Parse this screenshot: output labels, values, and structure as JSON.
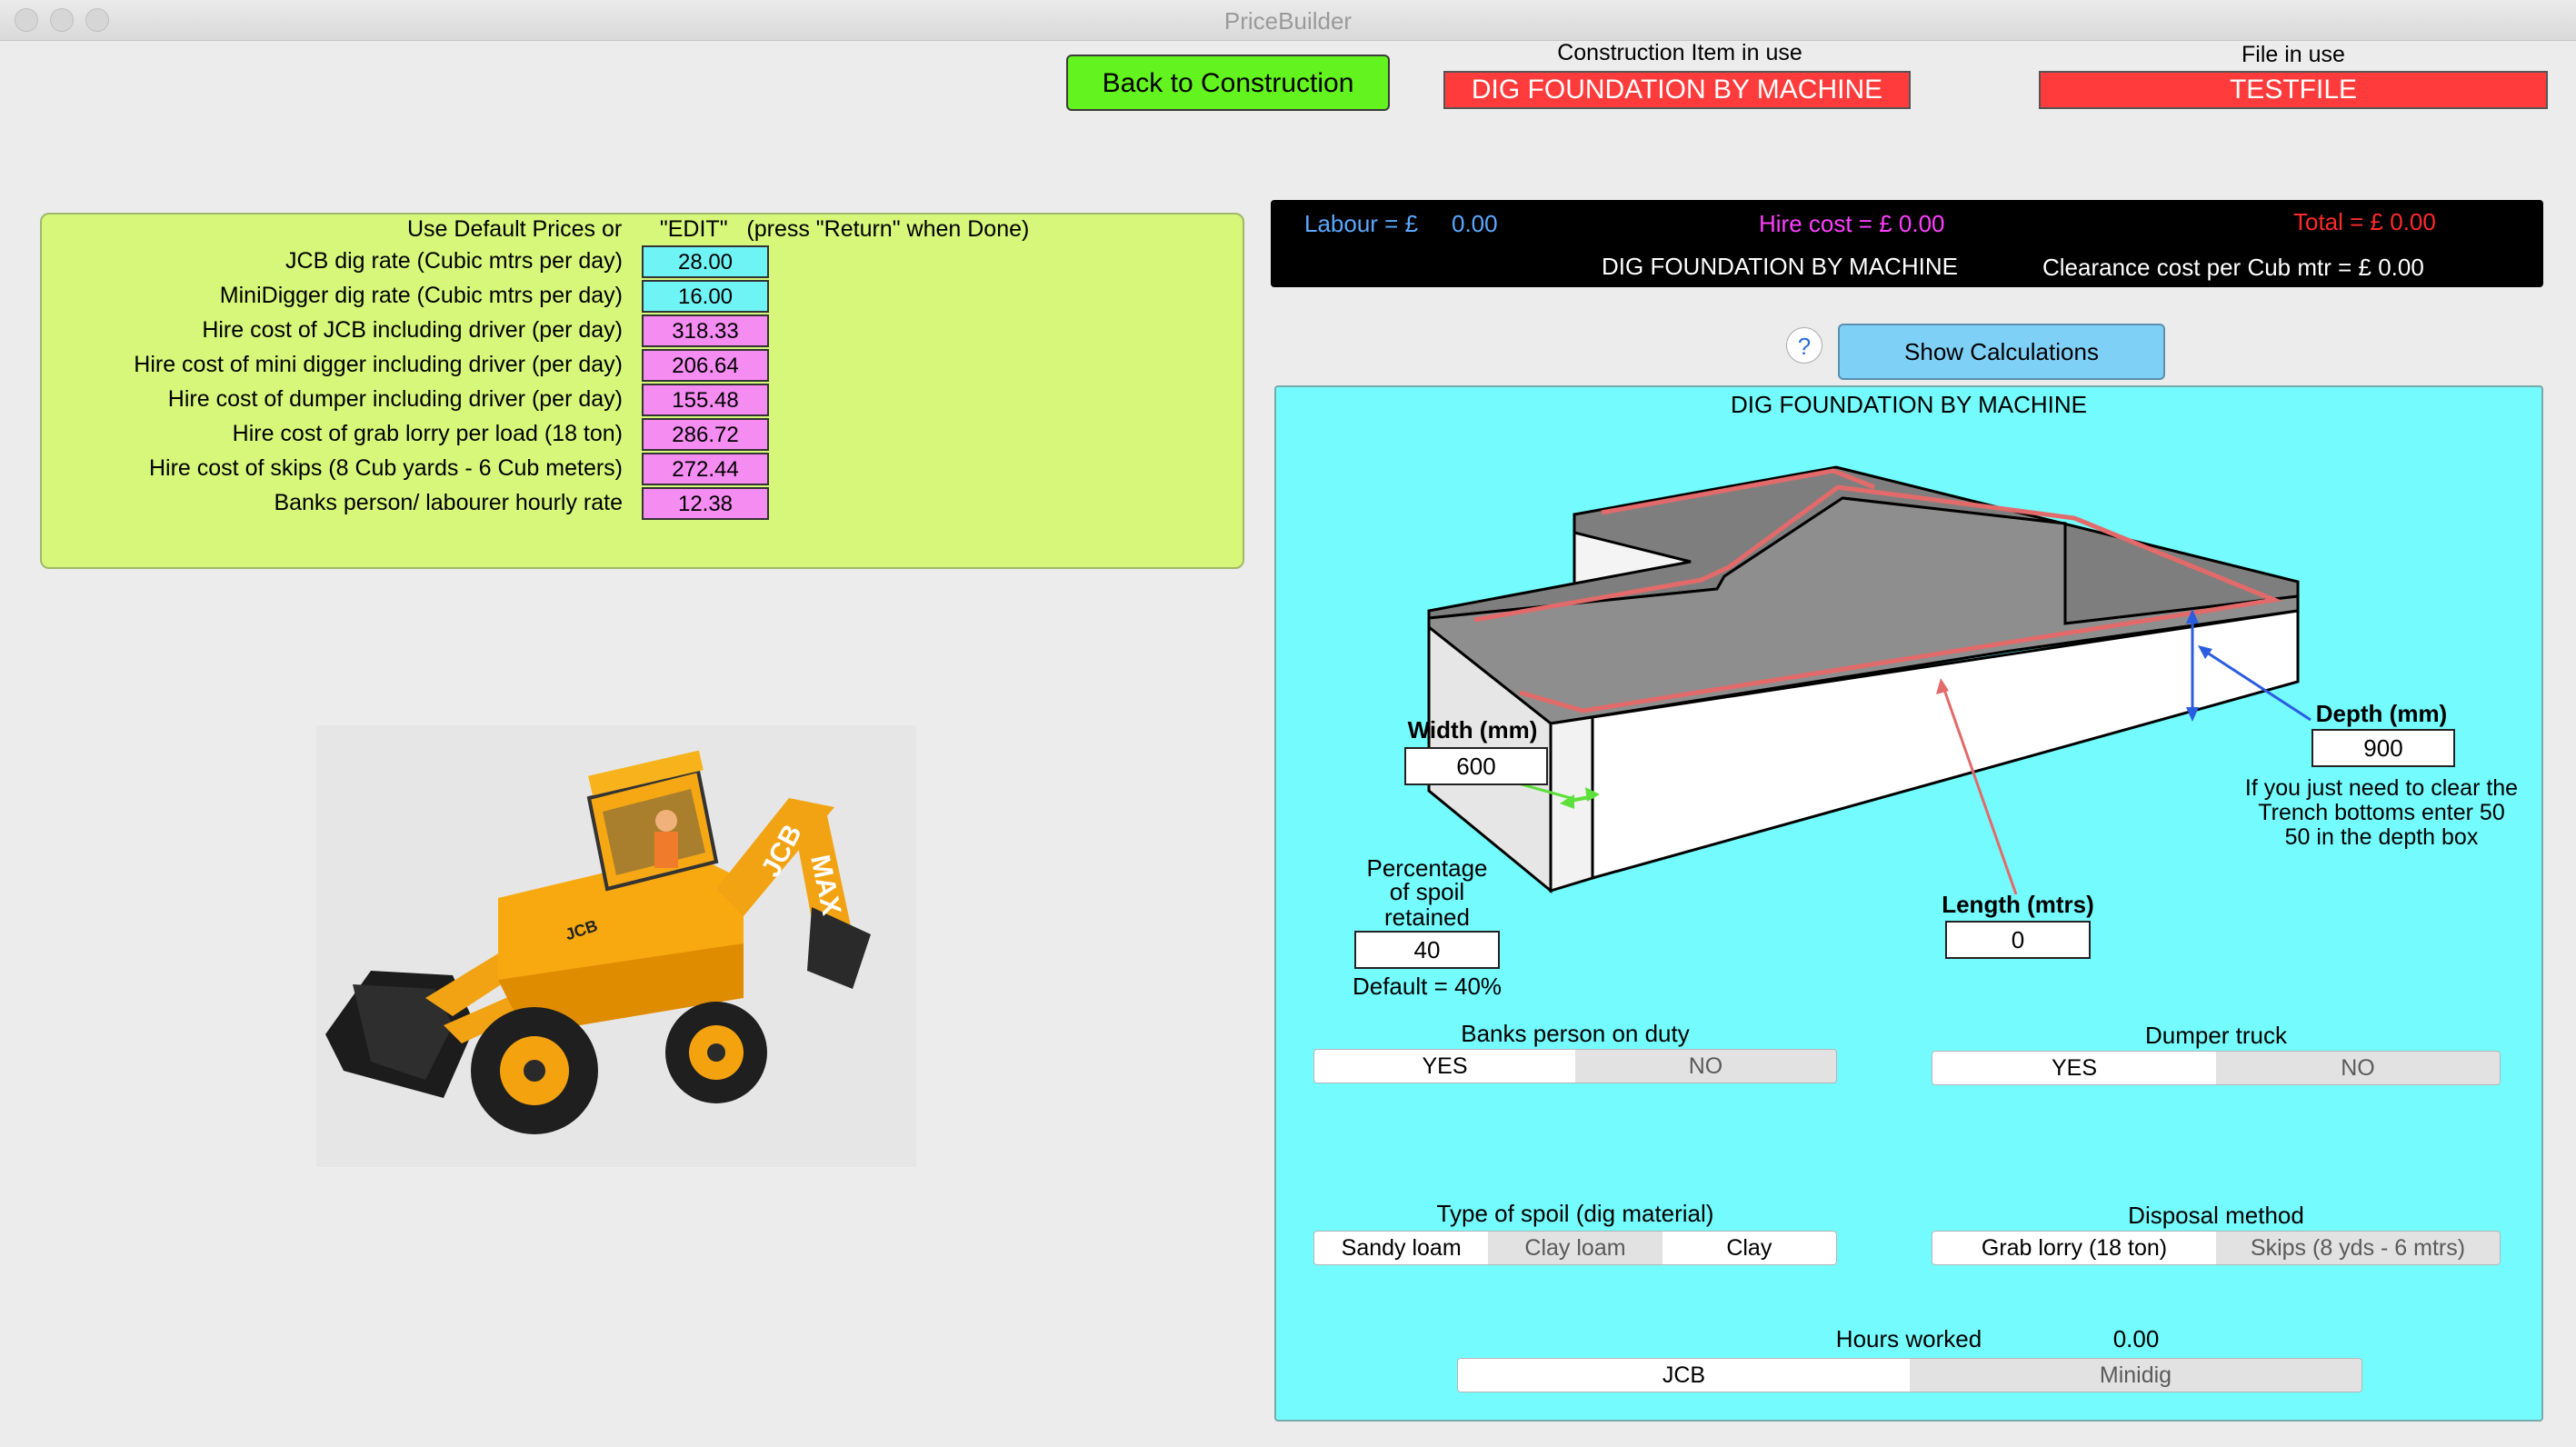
{
  "window": {
    "title": "PriceBuilder"
  },
  "header": {
    "back_button": "Back to Construction",
    "item_label": "Construction Item in use",
    "item_value": "DIG FOUNDATION BY MACHINE",
    "file_label": "File in use",
    "file_value": "TESTFILE"
  },
  "prices": {
    "heading": "Use Default Prices or      \"EDIT\"   (press \"Return\" when Done)",
    "rows": [
      {
        "label": "JCB dig rate (Cubic mtrs per day)",
        "value": "28.00",
        "color": "#6ff4f6"
      },
      {
        "label": "MiniDigger dig rate (Cubic mtrs per day)",
        "value": "16.00",
        "color": "#6ff4f6"
      },
      {
        "label": "Hire cost of JCB including driver (per day)",
        "value": "318.33",
        "color": "#f58cf2"
      },
      {
        "label": "Hire cost of mini digger including driver (per day)",
        "value": "206.64",
        "color": "#f58cf2"
      },
      {
        "label": "Hire cost of dumper including driver (per day)",
        "value": "155.48",
        "color": "#f58cf2"
      },
      {
        "label": "Hire cost of grab lorry per load (18 ton)",
        "value": "286.72",
        "color": "#f58cf2"
      },
      {
        "label": "Hire cost of skips (8 Cub yards - 6 Cub meters)",
        "value": "272.44",
        "color": "#f58cf2"
      },
      {
        "label": "Banks person/ labourer hourly rate",
        "value": "12.38",
        "color": "#f58cf2"
      }
    ]
  },
  "summary": {
    "labour": "Labour = £",
    "labour_value": "0.00",
    "hire": "Hire cost = £ 0.00",
    "total": "Total = £  0.00",
    "item": "DIG FOUNDATION BY MACHINE",
    "clearance": "Clearance cost per Cub mtr = £  0.00",
    "colors": {
      "labour": "#5aa8ff",
      "hire": "#ff3fff",
      "total": "#ff2a2a"
    }
  },
  "help": {
    "icon": "?"
  },
  "show_calc": "Show Calculations",
  "panel": {
    "title": "DIG FOUNDATION BY MACHINE",
    "width_label": "Width (mm)",
    "width_value": "600",
    "depth_label": "Depth (mm)",
    "depth_value": "900",
    "depth_note_1": "If you just need to clear the",
    "depth_note_2": "Trench bottoms enter 50",
    "depth_note_3": "50 in the depth box",
    "length_label": "Length (mtrs)",
    "length_value": "0",
    "spoil_label_1": "Percentage",
    "spoil_label_2": "of spoil",
    "spoil_label_3": "retained",
    "spoil_value": "40",
    "spoil_default": "Default = 40%",
    "banks_label": "Banks person on duty",
    "banks_options": [
      "YES",
      "NO"
    ],
    "dumper_label": "Dumper truck",
    "dumper_options": [
      "YES",
      "NO"
    ],
    "spoil_type_label": "Type of spoil (dig material)",
    "spoil_type_options": [
      "Sandy loam",
      "Clay loam",
      "Clay"
    ],
    "disposal_label": "Disposal method",
    "disposal_options": [
      "Grab lorry (18 ton)",
      "Skips (8 yds - 6 mtrs)"
    ],
    "hours_label": "Hours worked",
    "hours_value": "0.00",
    "machine_options": [
      "JCB",
      "Minidig"
    ]
  },
  "image": {
    "digger_text_1": "JCB",
    "digger_text_2": "JCB",
    "digger_text_3": "MAX"
  }
}
